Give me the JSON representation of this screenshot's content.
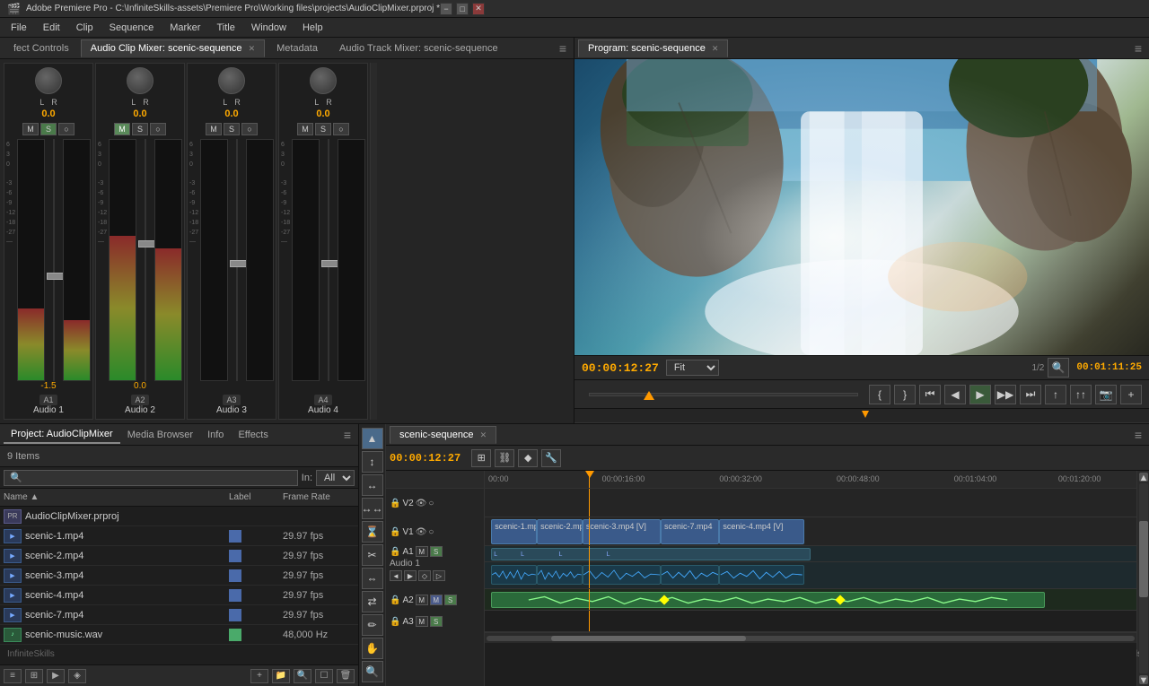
{
  "titlebar": {
    "title": "Adobe Premiere Pro - C:\\InfiniteSkills-assets\\Premiere Pro\\Working files\\projects\\AudioClipMixer.prproj *",
    "min": "−",
    "max": "□",
    "close": "✕"
  },
  "menubar": {
    "items": [
      "File",
      "Edit",
      "Clip",
      "Sequence",
      "Marker",
      "Title",
      "Window",
      "Help"
    ]
  },
  "tabs": {
    "effect_controls": "fect Controls",
    "audio_clip_mixer": "Audio Clip Mixer: scenic-sequence",
    "metadata": "Metadata",
    "audio_track_mixer": "Audio Track Mixer: scenic-sequence"
  },
  "channels": [
    {
      "id": "A1",
      "name": "Audio 1",
      "db": "-1.5",
      "lr": [
        "L",
        "R"
      ]
    },
    {
      "id": "A2",
      "name": "Audio 2",
      "db": "0.0",
      "lr": [
        "L",
        "R"
      ]
    },
    {
      "id": "A3",
      "name": "Audio 3",
      "db": "",
      "lr": [
        "L",
        "R"
      ]
    },
    {
      "id": "A4",
      "name": "Audio 4",
      "db": "",
      "lr": [
        "L",
        "R"
      ]
    }
  ],
  "program": {
    "title": "Program: scenic-sequence",
    "timecode_current": "00:00:12:27",
    "timecode_total": "00:01:11:25",
    "fit": "Fit",
    "fraction": "1/2"
  },
  "project": {
    "title": "Project: AudioClipMixer",
    "tabs": [
      "Project: AudioClipMixer",
      "Media Browser",
      "Info",
      "Effects"
    ],
    "items_count": "9 Items",
    "search_placeholder": "🔍",
    "in_label": "In:",
    "in_value": "All",
    "columns": {
      "name": "Name ▲",
      "label": "Label",
      "frame_rate": "Frame Rate"
    },
    "files": [
      {
        "name": "scenic-1.mp4",
        "type": "video",
        "rate": "29.97 fps"
      },
      {
        "name": "scenic-2.mp4",
        "type": "video",
        "rate": "29.97 fps"
      },
      {
        "name": "scenic-3.mp4",
        "type": "video",
        "rate": "29.97 fps"
      },
      {
        "name": "scenic-4.mp4",
        "type": "video",
        "rate": "29.97 fps"
      },
      {
        "name": "scenic-7.mp4",
        "type": "video",
        "rate": "29.97 fps"
      },
      {
        "name": "scenic-music.wav",
        "type": "audio",
        "rate": "48,000 Hz"
      }
    ]
  },
  "timeline": {
    "sequence_name": "scenic-sequence",
    "timecode": "00:00:12:27",
    "timescale": [
      "00:00",
      "00:00:16:00",
      "00:00:32:00",
      "00:00:48:00",
      "00:01:04:00",
      "00:01:20:00"
    ],
    "tracks": [
      {
        "id": "V2",
        "type": "video",
        "label": "V2"
      },
      {
        "id": "V1",
        "type": "video",
        "label": "V1"
      },
      {
        "id": "A1",
        "type": "audio",
        "label": "A1",
        "name": "Audio 1"
      },
      {
        "id": "A2",
        "type": "audio",
        "label": "A2"
      },
      {
        "id": "A3",
        "type": "audio",
        "label": "A3"
      }
    ],
    "clips_v1": [
      "scenic-1.mp",
      "scenic-2.mp",
      "scenic-3.mp4 [V]",
      "scenic-7.mp4",
      "scenic-4.mp4 [V]"
    ]
  },
  "tools": [
    "▼",
    "↕",
    "✂",
    "◈",
    "↔",
    "↔",
    "✏",
    "🔍"
  ],
  "colors": {
    "accent_orange": "#f90000",
    "timecode": "#ffaa00",
    "active_green": "#4a8a4a"
  }
}
